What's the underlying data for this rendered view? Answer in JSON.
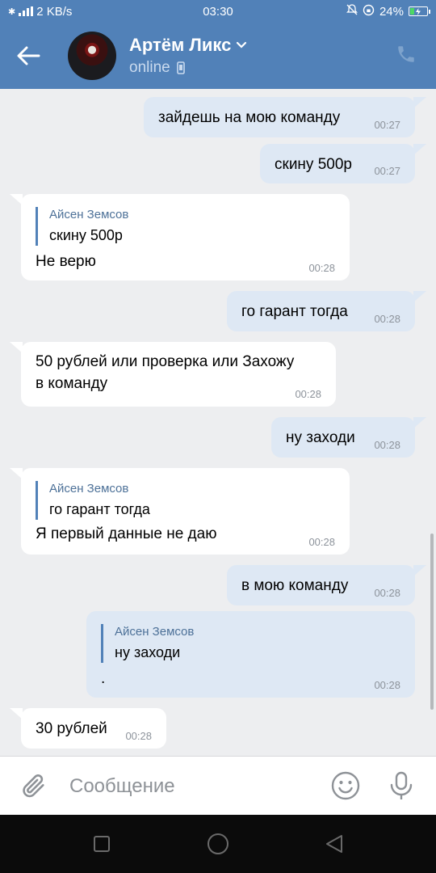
{
  "status_bar": {
    "network_speed": "2 KB/s",
    "time": "03:30",
    "battery": "24%",
    "battery_level": 0.24
  },
  "header": {
    "contact_name": "Артём Ликс",
    "status": "online",
    "back_icon": "back-arrow-icon",
    "call_icon": "phone-icon"
  },
  "messages": [
    {
      "direction": "out",
      "text": "зайдешь на мою команду",
      "time": "00:27"
    },
    {
      "direction": "out",
      "text": "скину 500р",
      "time": "00:27"
    },
    {
      "direction": "in",
      "reply_author": "Айсен Земсов",
      "reply_text": "скину 500р",
      "text": "Не верю",
      "time": "00:28"
    },
    {
      "direction": "out",
      "text": "го гарант тогда",
      "time": "00:28"
    },
    {
      "direction": "in",
      "text_line1": "50 рублей или проверка или Захожу",
      "text_line2": "в команду",
      "time": "00:28"
    },
    {
      "direction": "out",
      "text": "ну заходи",
      "time": "00:28"
    },
    {
      "direction": "in",
      "reply_author": "Айсен Земсов",
      "reply_text": "го гарант тогда",
      "text": "Я первый данные не даю",
      "time": "00:28"
    },
    {
      "direction": "out",
      "text": "в мою команду",
      "time": "00:28"
    },
    {
      "direction": "out",
      "reply_author": "Айсен Земсов",
      "reply_text": "ну заходи",
      "text": ".",
      "time": "00:28"
    },
    {
      "direction": "in",
      "text": "30 рублей",
      "time": "00:28"
    }
  ],
  "composer": {
    "placeholder": "Сообщение",
    "attach_icon": "paperclip-icon",
    "emoji_icon": "smiley-icon",
    "voice_icon": "microphone-icon"
  },
  "colors": {
    "header_blue": "#5181b8",
    "background": "#edeef0",
    "outgoing_bubble": "#dee8f4",
    "incoming_bubble": "#ffffff",
    "reply_name": "#4d7198",
    "timestamp": "#8d939b"
  }
}
